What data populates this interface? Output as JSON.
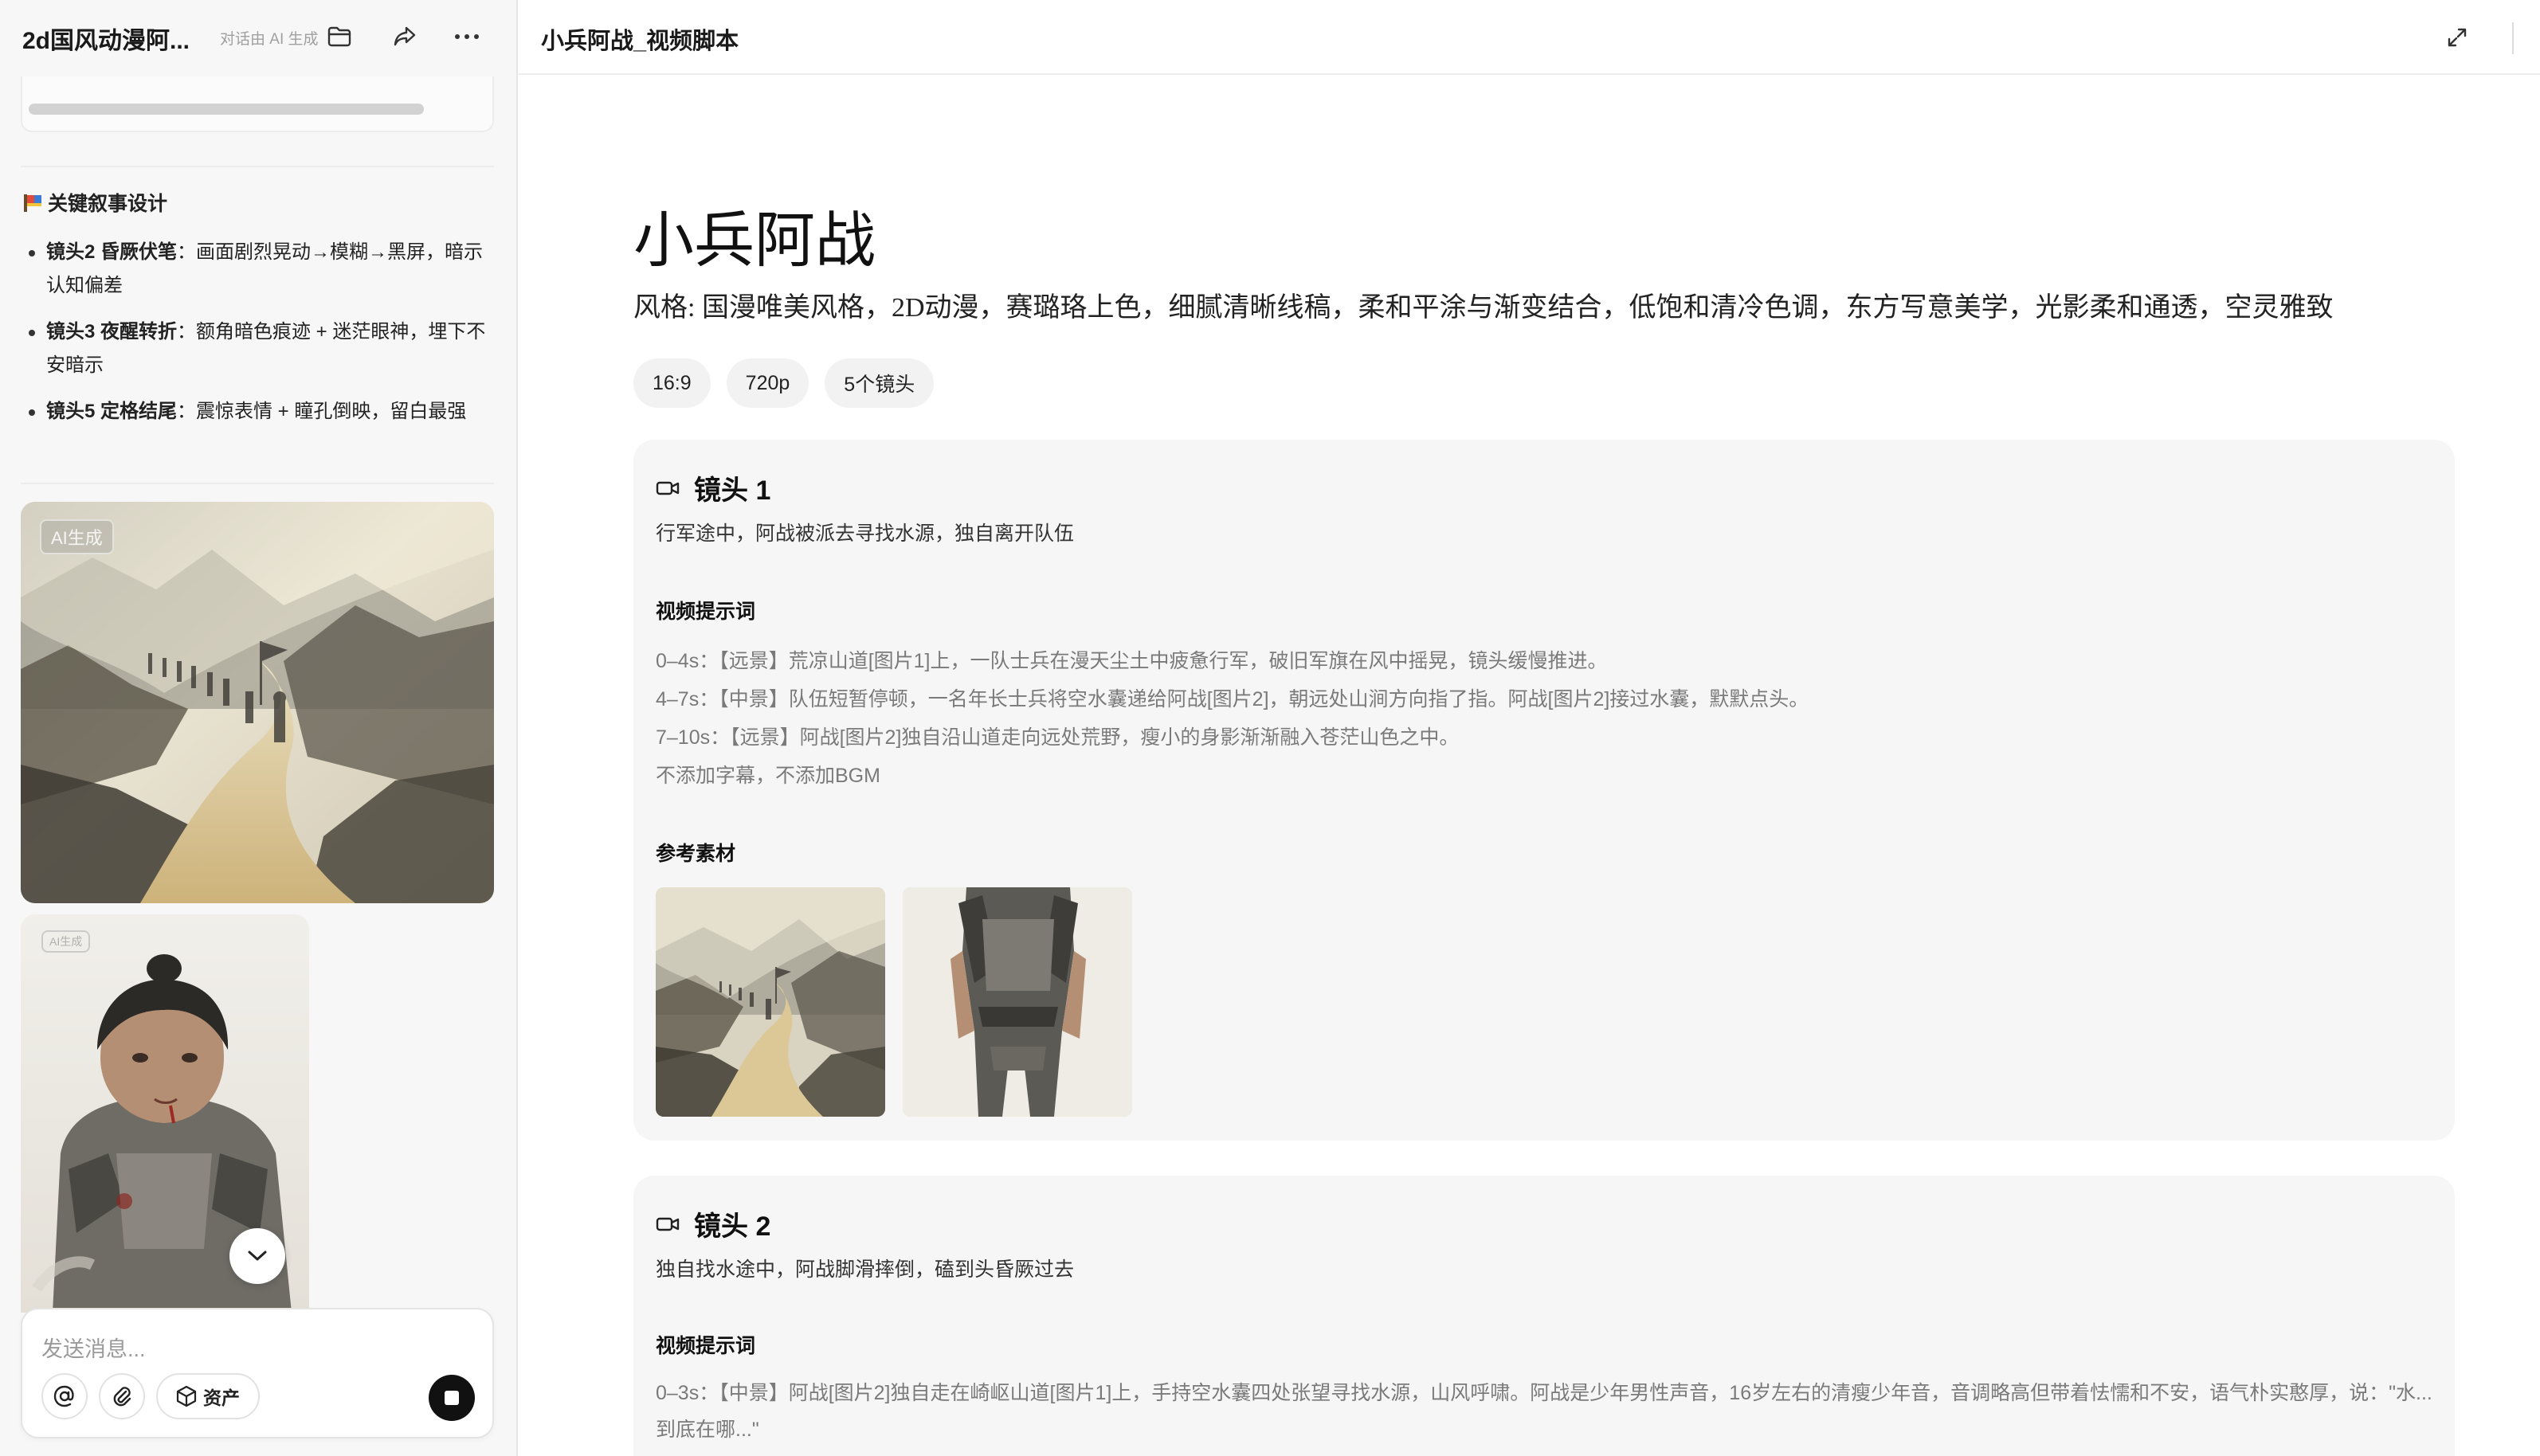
{
  "left_panel": {
    "conversation_title": "2d国风动漫阿...",
    "generated_note": "对话由 AI 生成",
    "section_title": "关键叙事设计",
    "bullets": [
      {
        "label": "镜头2 昏厥伏笔",
        "text": "：画面剧烈晃动→模糊→黑屏，暗示认知偏差"
      },
      {
        "label": "镜头3 夜醒转折",
        "text": "：额角暗色痕迹 + 迷茫眼神，埋下不安暗示"
      },
      {
        "label": "镜头5 定格结尾",
        "text": "：震惊表情 + 瞳孔倒映，留白最强"
      }
    ],
    "image_badge": "AI生成",
    "image_badge_small": "AI生成",
    "composer": {
      "placeholder": "发送消息...",
      "assets_label": "资产"
    }
  },
  "doc": {
    "tab_title": "小兵阿战_视频脚本",
    "title": "小兵阿战",
    "style": "风格: 国漫唯美风格，2D动漫，赛璐珞上色，细腻清晰线稿，柔和平涂与渐变结合，低饱和清冷色调，东方写意美学，光影柔和通透，空灵雅致",
    "chips": [
      "16:9",
      "720p",
      "5个镜头"
    ],
    "shots": [
      {
        "title": "镜头 1",
        "desc": "行军途中，阿战被派去寻找水源，独自离开队伍",
        "prompt_heading": "视频提示词",
        "prompt_lines": [
          "0–4s：【远景】荒凉山道[图片1]上，一队士兵在漫天尘土中疲惫行军，破旧军旗在风中摇晃，镜头缓慢推进。",
          "4–7s：【中景】队伍短暂停顿，一名年长士兵将空水囊递给阿战[图片2]，朝远处山涧方向指了指。阿战[图片2]接过水囊，默默点头。",
          "7–10s：【远景】阿战[图片2]独自沿山道走向远处荒野，瘦小的身影渐渐融入苍茫山色之中。",
          "不添加字幕，不添加BGM"
        ],
        "refs_heading": "参考素材"
      },
      {
        "title": "镜头 2",
        "desc": "独自找水途中，阿战脚滑摔倒，磕到头昏厥过去",
        "prompt_heading": "视频提示词",
        "prompt_lines": [
          "0–3s：【中景】阿战[图片2]独自走在崎岖山道[图片1]上，手持空水囊四处张望寻找水源，山风呼啸。阿战是少年男性声音，16岁左右的清瘦少年音，音调略高但带着怯懦和不安，语气朴实憨厚，说：\"水...到底在哪...\""
        ]
      }
    ]
  }
}
